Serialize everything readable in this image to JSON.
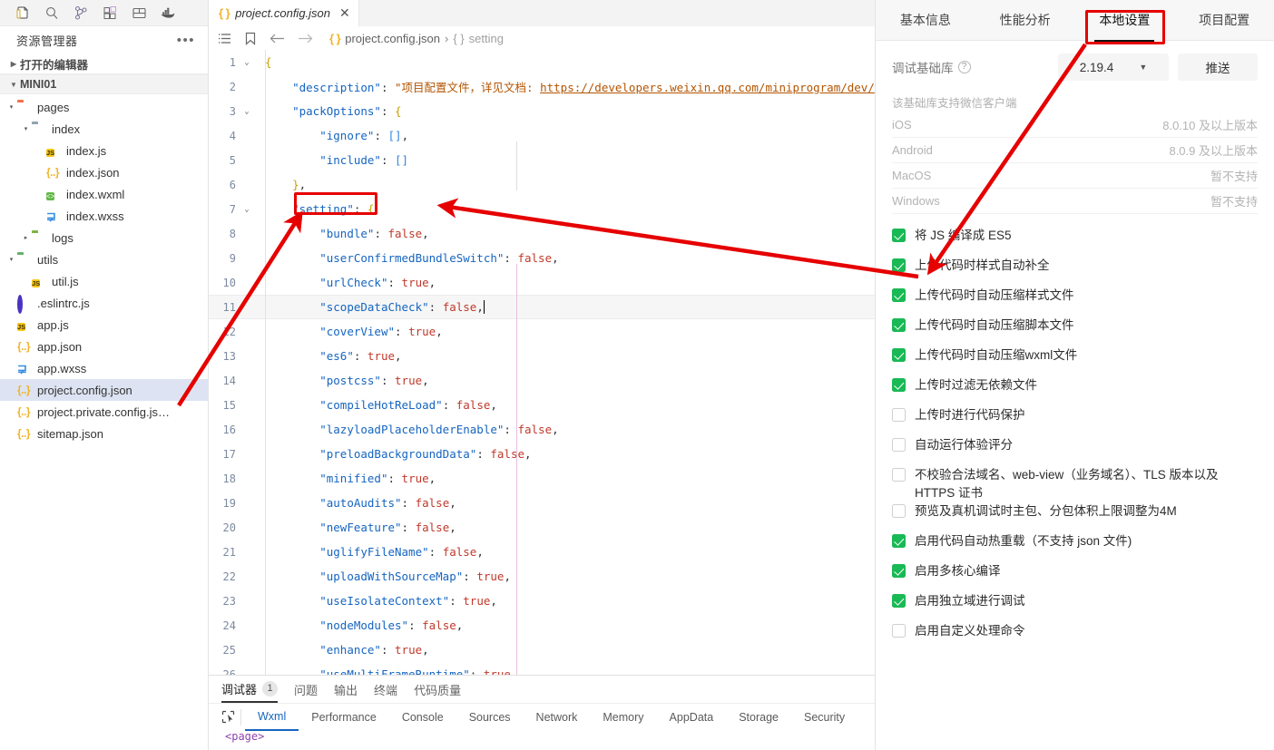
{
  "activity_bar": {
    "icons": [
      {
        "name": "explorer-icon",
        "title": "资源管理器"
      },
      {
        "name": "search-icon",
        "title": "搜索"
      },
      {
        "name": "source-control-icon",
        "title": "源代码管理"
      },
      {
        "name": "extensions-icon",
        "title": "扩展"
      },
      {
        "name": "layout-icon",
        "title": "布局"
      },
      {
        "name": "docker-icon",
        "title": "Docker"
      }
    ]
  },
  "explorer": {
    "title": "资源管理器",
    "more_label": "•••",
    "open_editors_label": "打开的编辑器",
    "project_name": "MINI01",
    "tree": [
      {
        "label": "pages",
        "icon": "folder-orange",
        "depth": 1,
        "twisty": "▾",
        "selected": false
      },
      {
        "label": "index",
        "icon": "folder-gray",
        "depth": 2,
        "twisty": "▾",
        "selected": false
      },
      {
        "label": "index.js",
        "icon": "js",
        "depth": 3,
        "twisty": "",
        "selected": false
      },
      {
        "label": "index.json",
        "icon": "json",
        "depth": 3,
        "twisty": "",
        "selected": false
      },
      {
        "label": "index.wxml",
        "icon": "wxml",
        "depth": 3,
        "twisty": "",
        "selected": false
      },
      {
        "label": "index.wxss",
        "icon": "wxss",
        "depth": 3,
        "twisty": "",
        "selected": false
      },
      {
        "label": "logs",
        "icon": "folder-green",
        "depth": 2,
        "twisty": "▸",
        "selected": false
      },
      {
        "label": "utils",
        "icon": "folder-teal",
        "depth": 1,
        "twisty": "▾",
        "selected": false
      },
      {
        "label": "util.js",
        "icon": "js",
        "depth": 2,
        "twisty": "",
        "selected": false
      },
      {
        "label": ".eslintrc.js",
        "icon": "eslint",
        "depth": 1,
        "twisty": "",
        "selected": false
      },
      {
        "label": "app.js",
        "icon": "js",
        "depth": 1,
        "twisty": "",
        "selected": false
      },
      {
        "label": "app.json",
        "icon": "json",
        "depth": 1,
        "twisty": "",
        "selected": false
      },
      {
        "label": "app.wxss",
        "icon": "wxss",
        "depth": 1,
        "twisty": "",
        "selected": false
      },
      {
        "label": "project.config.json",
        "icon": "json",
        "depth": 1,
        "twisty": "",
        "selected": true
      },
      {
        "label": "project.private.config.js…",
        "icon": "json",
        "depth": 1,
        "twisty": "",
        "selected": false
      },
      {
        "label": "sitemap.json",
        "icon": "json",
        "depth": 1,
        "twisty": "",
        "selected": false
      }
    ]
  },
  "editor": {
    "tab": {
      "label": "project.config.json",
      "icon": "json-icon",
      "close": "✕"
    },
    "breadcrumb": {
      "file": "project.config.json",
      "separator": "›",
      "symbol_icon": "{ }",
      "symbol": "setting"
    },
    "lines": [
      {
        "num": "1",
        "fold": "⌄",
        "highlight": false,
        "tokens": [
          {
            "t": "{",
            "c": "br"
          }
        ]
      },
      {
        "num": "2",
        "fold": "",
        "highlight": false,
        "tokens": [
          {
            "t": "    ",
            "c": "p"
          },
          {
            "t": "\"description\"",
            "c": "k"
          },
          {
            "t": ": ",
            "c": "p"
          },
          {
            "t": "\"项目配置文件，详见文档: ",
            "c": "s"
          },
          {
            "t": "https://developers.weixin.qq.com/miniprogram/dev/",
            "c": "u"
          }
        ]
      },
      {
        "num": "3",
        "fold": "⌄",
        "highlight": false,
        "tokens": [
          {
            "t": "    ",
            "c": "p"
          },
          {
            "t": "\"packOptions\"",
            "c": "k"
          },
          {
            "t": ": ",
            "c": "p"
          },
          {
            "t": "{",
            "c": "br"
          }
        ]
      },
      {
        "num": "4",
        "fold": "",
        "highlight": false,
        "tokens": [
          {
            "t": "        ",
            "c": "p"
          },
          {
            "t": "\"ignore\"",
            "c": "k"
          },
          {
            "t": ": ",
            "c": "p"
          },
          {
            "t": "[]",
            "c": "ar"
          },
          {
            "t": ",",
            "c": "p"
          }
        ]
      },
      {
        "num": "5",
        "fold": "",
        "highlight": false,
        "tokens": [
          {
            "t": "        ",
            "c": "p"
          },
          {
            "t": "\"include\"",
            "c": "k"
          },
          {
            "t": ": ",
            "c": "p"
          },
          {
            "t": "[]",
            "c": "ar"
          }
        ]
      },
      {
        "num": "6",
        "fold": "",
        "highlight": false,
        "tokens": [
          {
            "t": "    ",
            "c": "p"
          },
          {
            "t": "}",
            "c": "br"
          },
          {
            "t": ",",
            "c": "p"
          }
        ]
      },
      {
        "num": "7",
        "fold": "⌄",
        "highlight": false,
        "tokens": [
          {
            "t": "    ",
            "c": "p"
          },
          {
            "t": "\"setting\"",
            "c": "k"
          },
          {
            "t": ": ",
            "c": "p"
          },
          {
            "t": "{",
            "c": "br"
          }
        ]
      },
      {
        "num": "8",
        "fold": "",
        "highlight": false,
        "tokens": [
          {
            "t": "        ",
            "c": "p"
          },
          {
            "t": "\"bundle\"",
            "c": "k"
          },
          {
            "t": ": ",
            "c": "p"
          },
          {
            "t": "false",
            "c": "b"
          },
          {
            "t": ",",
            "c": "p"
          }
        ]
      },
      {
        "num": "9",
        "fold": "",
        "highlight": false,
        "tokens": [
          {
            "t": "        ",
            "c": "p"
          },
          {
            "t": "\"userConfirmedBundleSwitch\"",
            "c": "k"
          },
          {
            "t": ": ",
            "c": "p"
          },
          {
            "t": "false",
            "c": "b"
          },
          {
            "t": ",",
            "c": "p"
          }
        ]
      },
      {
        "num": "10",
        "fold": "",
        "highlight": false,
        "tokens": [
          {
            "t": "        ",
            "c": "p"
          },
          {
            "t": "\"urlCheck\"",
            "c": "k"
          },
          {
            "t": ": ",
            "c": "p"
          },
          {
            "t": "true",
            "c": "b"
          },
          {
            "t": ",",
            "c": "p"
          }
        ]
      },
      {
        "num": "11",
        "fold": "",
        "highlight": true,
        "tokens": [
          {
            "t": "        ",
            "c": "p"
          },
          {
            "t": "\"scopeDataCheck\"",
            "c": "k"
          },
          {
            "t": ": ",
            "c": "p"
          },
          {
            "t": "false",
            "c": "b"
          },
          {
            "t": ",",
            "c": "p"
          }
        ],
        "caret": true
      },
      {
        "num": "12",
        "fold": "",
        "highlight": false,
        "tokens": [
          {
            "t": "        ",
            "c": "p"
          },
          {
            "t": "\"coverView\"",
            "c": "k"
          },
          {
            "t": ": ",
            "c": "p"
          },
          {
            "t": "true",
            "c": "b"
          },
          {
            "t": ",",
            "c": "p"
          }
        ]
      },
      {
        "num": "13",
        "fold": "",
        "highlight": false,
        "tokens": [
          {
            "t": "        ",
            "c": "p"
          },
          {
            "t": "\"es6\"",
            "c": "k"
          },
          {
            "t": ": ",
            "c": "p"
          },
          {
            "t": "true",
            "c": "b"
          },
          {
            "t": ",",
            "c": "p"
          }
        ]
      },
      {
        "num": "14",
        "fold": "",
        "highlight": false,
        "tokens": [
          {
            "t": "        ",
            "c": "p"
          },
          {
            "t": "\"postcss\"",
            "c": "k"
          },
          {
            "t": ": ",
            "c": "p"
          },
          {
            "t": "true",
            "c": "b"
          },
          {
            "t": ",",
            "c": "p"
          }
        ]
      },
      {
        "num": "15",
        "fold": "",
        "highlight": false,
        "tokens": [
          {
            "t": "        ",
            "c": "p"
          },
          {
            "t": "\"compileHotReLoad\"",
            "c": "k"
          },
          {
            "t": ": ",
            "c": "p"
          },
          {
            "t": "false",
            "c": "b"
          },
          {
            "t": ",",
            "c": "p"
          }
        ]
      },
      {
        "num": "16",
        "fold": "",
        "highlight": false,
        "tokens": [
          {
            "t": "        ",
            "c": "p"
          },
          {
            "t": "\"lazyloadPlaceholderEnable\"",
            "c": "k"
          },
          {
            "t": ": ",
            "c": "p"
          },
          {
            "t": "false",
            "c": "b"
          },
          {
            "t": ",",
            "c": "p"
          }
        ]
      },
      {
        "num": "17",
        "fold": "",
        "highlight": false,
        "tokens": [
          {
            "t": "        ",
            "c": "p"
          },
          {
            "t": "\"preloadBackgroundData\"",
            "c": "k"
          },
          {
            "t": ": ",
            "c": "p"
          },
          {
            "t": "false",
            "c": "b"
          },
          {
            "t": ",",
            "c": "p"
          }
        ]
      },
      {
        "num": "18",
        "fold": "",
        "highlight": false,
        "tokens": [
          {
            "t": "        ",
            "c": "p"
          },
          {
            "t": "\"minified\"",
            "c": "k"
          },
          {
            "t": ": ",
            "c": "p"
          },
          {
            "t": "true",
            "c": "b"
          },
          {
            "t": ",",
            "c": "p"
          }
        ]
      },
      {
        "num": "19",
        "fold": "",
        "highlight": false,
        "tokens": [
          {
            "t": "        ",
            "c": "p"
          },
          {
            "t": "\"autoAudits\"",
            "c": "k"
          },
          {
            "t": ": ",
            "c": "p"
          },
          {
            "t": "false",
            "c": "b"
          },
          {
            "t": ",",
            "c": "p"
          }
        ]
      },
      {
        "num": "20",
        "fold": "",
        "highlight": false,
        "tokens": [
          {
            "t": "        ",
            "c": "p"
          },
          {
            "t": "\"newFeature\"",
            "c": "k"
          },
          {
            "t": ": ",
            "c": "p"
          },
          {
            "t": "false",
            "c": "b"
          },
          {
            "t": ",",
            "c": "p"
          }
        ]
      },
      {
        "num": "21",
        "fold": "",
        "highlight": false,
        "tokens": [
          {
            "t": "        ",
            "c": "p"
          },
          {
            "t": "\"uglifyFileName\"",
            "c": "k"
          },
          {
            "t": ": ",
            "c": "p"
          },
          {
            "t": "false",
            "c": "b"
          },
          {
            "t": ",",
            "c": "p"
          }
        ]
      },
      {
        "num": "22",
        "fold": "",
        "highlight": false,
        "tokens": [
          {
            "t": "        ",
            "c": "p"
          },
          {
            "t": "\"uploadWithSourceMap\"",
            "c": "k"
          },
          {
            "t": ": ",
            "c": "p"
          },
          {
            "t": "true",
            "c": "b"
          },
          {
            "t": ",",
            "c": "p"
          }
        ]
      },
      {
        "num": "23",
        "fold": "",
        "highlight": false,
        "tokens": [
          {
            "t": "        ",
            "c": "p"
          },
          {
            "t": "\"useIsolateContext\"",
            "c": "k"
          },
          {
            "t": ": ",
            "c": "p"
          },
          {
            "t": "true",
            "c": "b"
          },
          {
            "t": ",",
            "c": "p"
          }
        ]
      },
      {
        "num": "24",
        "fold": "",
        "highlight": false,
        "tokens": [
          {
            "t": "        ",
            "c": "p"
          },
          {
            "t": "\"nodeModules\"",
            "c": "k"
          },
          {
            "t": ": ",
            "c": "p"
          },
          {
            "t": "false",
            "c": "b"
          },
          {
            "t": ",",
            "c": "p"
          }
        ]
      },
      {
        "num": "25",
        "fold": "",
        "highlight": false,
        "tokens": [
          {
            "t": "        ",
            "c": "p"
          },
          {
            "t": "\"enhance\"",
            "c": "k"
          },
          {
            "t": ": ",
            "c": "p"
          },
          {
            "t": "true",
            "c": "b"
          },
          {
            "t": ",",
            "c": "p"
          }
        ]
      },
      {
        "num": "26",
        "fold": "",
        "highlight": false,
        "tokens": [
          {
            "t": "        ",
            "c": "p"
          },
          {
            "t": "\"useMultiFrameRuntime\"",
            "c": "k"
          },
          {
            "t": ": ",
            "c": "p"
          },
          {
            "t": "true",
            "c": "b"
          },
          {
            "t": ",",
            "c": "p"
          }
        ]
      }
    ]
  },
  "dev_panel": {
    "primary_tabs": [
      {
        "label": "调试器",
        "badge": "1",
        "active": true
      },
      {
        "label": "问题",
        "badge": "",
        "active": false
      },
      {
        "label": "输出",
        "badge": "",
        "active": false
      },
      {
        "label": "终端",
        "badge": "",
        "active": false
      },
      {
        "label": "代码质量",
        "badge": "",
        "active": false
      }
    ],
    "secondary_tabs": [
      {
        "label": "Wxml",
        "active": true
      },
      {
        "label": "Performance",
        "active": false
      },
      {
        "label": "Console",
        "active": false
      },
      {
        "label": "Sources",
        "active": false
      },
      {
        "label": "Network",
        "active": false
      },
      {
        "label": "Memory",
        "active": false
      },
      {
        "label": "AppData",
        "active": false
      },
      {
        "label": "Storage",
        "active": false
      },
      {
        "label": "Security",
        "active": false
      }
    ],
    "content": "<page>"
  },
  "settings_panel": {
    "tabs": [
      {
        "label": "基本信息",
        "active": false
      },
      {
        "label": "性能分析",
        "active": false
      },
      {
        "label": "本地设置",
        "active": true
      },
      {
        "label": "项目配置",
        "active": false
      }
    ],
    "base_library": {
      "label": "调试基础库",
      "help_icon": "?",
      "version": "2.19.4",
      "chevron": "▼",
      "push_label": "推送"
    },
    "support": {
      "note": "该基础库支持微信客户端",
      "rows": [
        {
          "platform": "iOS",
          "value": "8.0.10 及以上版本"
        },
        {
          "platform": "Android",
          "value": "8.0.9 及以上版本"
        },
        {
          "platform": "MacOS",
          "value": "暂不支持"
        },
        {
          "platform": "Windows",
          "value": "暂不支持"
        }
      ]
    },
    "checkboxes": [
      {
        "label": "将 JS 编译成 ES5",
        "checked": true
      },
      {
        "label": "上传代码时样式自动补全",
        "checked": true
      },
      {
        "label": "上传代码时自动压缩样式文件",
        "checked": true
      },
      {
        "label": "上传代码时自动压缩脚本文件",
        "checked": true
      },
      {
        "label": "上传代码时自动压缩wxml文件",
        "checked": true
      },
      {
        "label": "上传时过滤无依赖文件",
        "checked": true
      },
      {
        "label": "上传时进行代码保护",
        "checked": false
      },
      {
        "label": "自动运行体验评分",
        "checked": false
      },
      {
        "label": "不校验合法域名、web-view（业务域名）、TLS 版本以及 HTTPS 证书",
        "checked": false
      },
      {
        "label": "预览及真机调试时主包、分包体积上限调整为4M",
        "checked": false
      },
      {
        "label": "启用代码自动热重载（不支持 json 文件)",
        "checked": true
      },
      {
        "label": "启用多核心编译",
        "checked": true
      },
      {
        "label": "启用独立域进行调试",
        "checked": true
      },
      {
        "label": "启用自定义处理命令",
        "checked": false
      }
    ]
  },
  "annotations": {
    "accent_color": "#e60000",
    "boxes": [
      {
        "name": "setting-key-highlight"
      },
      {
        "name": "local-settings-tab-highlight"
      }
    ],
    "arrows": [
      {
        "name": "arrow-file-to-setting"
      },
      {
        "name": "arrow-checkbox-to-setting"
      },
      {
        "name": "arrow-tab-to-checkboxes"
      }
    ]
  }
}
